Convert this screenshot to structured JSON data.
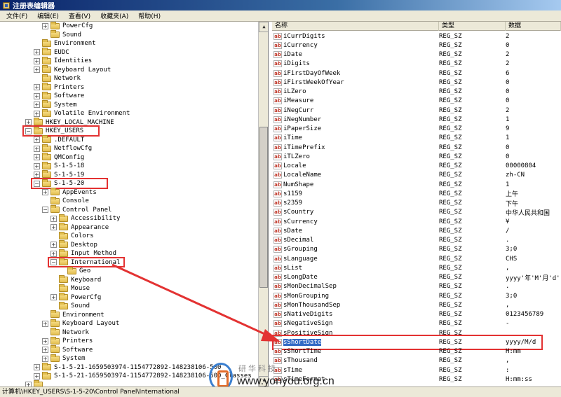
{
  "window": {
    "title": "注册表编辑器"
  },
  "menu": [
    "文件(F)",
    "编辑(E)",
    "查看(V)",
    "收藏夹(A)",
    "帮助(H)"
  ],
  "tree": [
    {
      "label": "PowerCfg",
      "indent": 4,
      "exp": "+"
    },
    {
      "label": "Sound",
      "indent": 4,
      "exp": ""
    },
    {
      "label": "Environment",
      "indent": 3,
      "exp": ""
    },
    {
      "label": "EUDC",
      "indent": 3,
      "exp": "+"
    },
    {
      "label": "Identities",
      "indent": 3,
      "exp": "+"
    },
    {
      "label": "Keyboard Layout",
      "indent": 3,
      "exp": "+"
    },
    {
      "label": "Network",
      "indent": 3,
      "exp": ""
    },
    {
      "label": "Printers",
      "indent": 3,
      "exp": "+"
    },
    {
      "label": "Software",
      "indent": 3,
      "exp": "+"
    },
    {
      "label": "System",
      "indent": 3,
      "exp": "+"
    },
    {
      "label": "Volatile Environment",
      "indent": 3,
      "exp": "+"
    },
    {
      "label": "HKEY_LOCAL_MACHINE",
      "indent": 2,
      "exp": "+"
    },
    {
      "label": "HKEY_USERS",
      "indent": 2,
      "exp": "-",
      "boxed": true
    },
    {
      "label": ".DEFAULT",
      "indent": 3,
      "exp": "+"
    },
    {
      "label": "NetflowCfg",
      "indent": 3,
      "exp": "+"
    },
    {
      "label": "QMConfig",
      "indent": 3,
      "exp": "+"
    },
    {
      "label": "S-1-5-18",
      "indent": 3,
      "exp": "+"
    },
    {
      "label": "S-1-5-19",
      "indent": 3,
      "exp": "+"
    },
    {
      "label": "S-1-5-20",
      "indent": 3,
      "exp": "-",
      "boxed": true
    },
    {
      "label": "AppEvents",
      "indent": 4,
      "exp": "+"
    },
    {
      "label": "Console",
      "indent": 4,
      "exp": ""
    },
    {
      "label": "Control Panel",
      "indent": 4,
      "exp": "-"
    },
    {
      "label": "Accessibility",
      "indent": 5,
      "exp": "+"
    },
    {
      "label": "Appearance",
      "indent": 5,
      "exp": "+"
    },
    {
      "label": "Colors",
      "indent": 5,
      "exp": ""
    },
    {
      "label": "Desktop",
      "indent": 5,
      "exp": "+"
    },
    {
      "label": "Input Method",
      "indent": 5,
      "exp": "+"
    },
    {
      "label": "International",
      "indent": 5,
      "exp": "-",
      "boxed": true
    },
    {
      "label": "Geo",
      "indent": 6,
      "exp": ""
    },
    {
      "label": "Keyboard",
      "indent": 5,
      "exp": ""
    },
    {
      "label": "Mouse",
      "indent": 5,
      "exp": ""
    },
    {
      "label": "PowerCfg",
      "indent": 5,
      "exp": "+"
    },
    {
      "label": "Sound",
      "indent": 5,
      "exp": ""
    },
    {
      "label": "Environment",
      "indent": 4,
      "exp": ""
    },
    {
      "label": "Keyboard Layout",
      "indent": 4,
      "exp": "+"
    },
    {
      "label": "Network",
      "indent": 4,
      "exp": ""
    },
    {
      "label": "Printers",
      "indent": 4,
      "exp": "+"
    },
    {
      "label": "Software",
      "indent": 4,
      "exp": "+"
    },
    {
      "label": "System",
      "indent": 4,
      "exp": "+"
    },
    {
      "label": "S-1-5-21-1659503974-1154772892-148238106-500",
      "indent": 3,
      "exp": "+"
    },
    {
      "label": "S-1-5-21-1659503974-1154772892-148238106-500_Classes",
      "indent": 3,
      "exp": "+"
    },
    {
      "label": "",
      "indent": 2,
      "exp": "+"
    }
  ],
  "list": {
    "headers": [
      "名称",
      "类型",
      "数据"
    ],
    "rows": [
      {
        "name": "iCurrDigits",
        "type": "REG_SZ",
        "data": "2"
      },
      {
        "name": "iCurrency",
        "type": "REG_SZ",
        "data": "0"
      },
      {
        "name": "iDate",
        "type": "REG_SZ",
        "data": "2"
      },
      {
        "name": "iDigits",
        "type": "REG_SZ",
        "data": "2"
      },
      {
        "name": "iFirstDayOfWeek",
        "type": "REG_SZ",
        "data": "6"
      },
      {
        "name": "iFirstWeekOfYear",
        "type": "REG_SZ",
        "data": "0"
      },
      {
        "name": "iLZero",
        "type": "REG_SZ",
        "data": "0"
      },
      {
        "name": "iMeasure",
        "type": "REG_SZ",
        "data": "0"
      },
      {
        "name": "iNegCurr",
        "type": "REG_SZ",
        "data": "2"
      },
      {
        "name": "iNegNumber",
        "type": "REG_SZ",
        "data": "1"
      },
      {
        "name": "iPaperSize",
        "type": "REG_SZ",
        "data": "9"
      },
      {
        "name": "iTime",
        "type": "REG_SZ",
        "data": "1"
      },
      {
        "name": "iTimePrefix",
        "type": "REG_SZ",
        "data": "0"
      },
      {
        "name": "iTLZero",
        "type": "REG_SZ",
        "data": "0"
      },
      {
        "name": "Locale",
        "type": "REG_SZ",
        "data": "00000804"
      },
      {
        "name": "LocaleName",
        "type": "REG_SZ",
        "data": "zh-CN"
      },
      {
        "name": "NumShape",
        "type": "REG_SZ",
        "data": "1"
      },
      {
        "name": "s1159",
        "type": "REG_SZ",
        "data": "上午"
      },
      {
        "name": "s2359",
        "type": "REG_SZ",
        "data": "下午"
      },
      {
        "name": "sCountry",
        "type": "REG_SZ",
        "data": "中华人民共和国"
      },
      {
        "name": "sCurrency",
        "type": "REG_SZ",
        "data": "¥"
      },
      {
        "name": "sDate",
        "type": "REG_SZ",
        "data": "/"
      },
      {
        "name": "sDecimal",
        "type": "REG_SZ",
        "data": "."
      },
      {
        "name": "sGrouping",
        "type": "REG_SZ",
        "data": "3;0"
      },
      {
        "name": "sLanguage",
        "type": "REG_SZ",
        "data": "CHS"
      },
      {
        "name": "sList",
        "type": "REG_SZ",
        "data": ","
      },
      {
        "name": "sLongDate",
        "type": "REG_SZ",
        "data": "yyyy'年'M'月'd'日"
      },
      {
        "name": "sMonDecimalSep",
        "type": "REG_SZ",
        "data": "."
      },
      {
        "name": "sMonGrouping",
        "type": "REG_SZ",
        "data": "3;0"
      },
      {
        "name": "sMonThousandSep",
        "type": "REG_SZ",
        "data": ","
      },
      {
        "name": "sNativeDigits",
        "type": "REG_SZ",
        "data": "0123456789"
      },
      {
        "name": "sNegativeSign",
        "type": "REG_SZ",
        "data": "-"
      },
      {
        "name": "sPositiveSign",
        "type": "REG_SZ",
        "data": ""
      },
      {
        "name": "sShortDate",
        "type": "REG_SZ",
        "data": "yyyy/M/d",
        "selected": true
      },
      {
        "name": "sShortTime",
        "type": "REG_SZ",
        "data": "H:mm"
      },
      {
        "name": "sThousand",
        "type": "REG_SZ",
        "data": ","
      },
      {
        "name": "sTime",
        "type": "REG_SZ",
        "data": ":"
      },
      {
        "name": "sTimeFormat",
        "type": "REG_SZ",
        "data": "H:mm:ss"
      }
    ]
  },
  "status": {
    "path": "计算机\\HKEY_USERS\\S-1-5-20\\Control Panel\\International"
  },
  "watermark": {
    "cn": "研华科技",
    "url": "www.yonyou.org.cn"
  },
  "colors": {
    "highlight_red": "#e33232",
    "selection_blue": "#316ac5"
  }
}
